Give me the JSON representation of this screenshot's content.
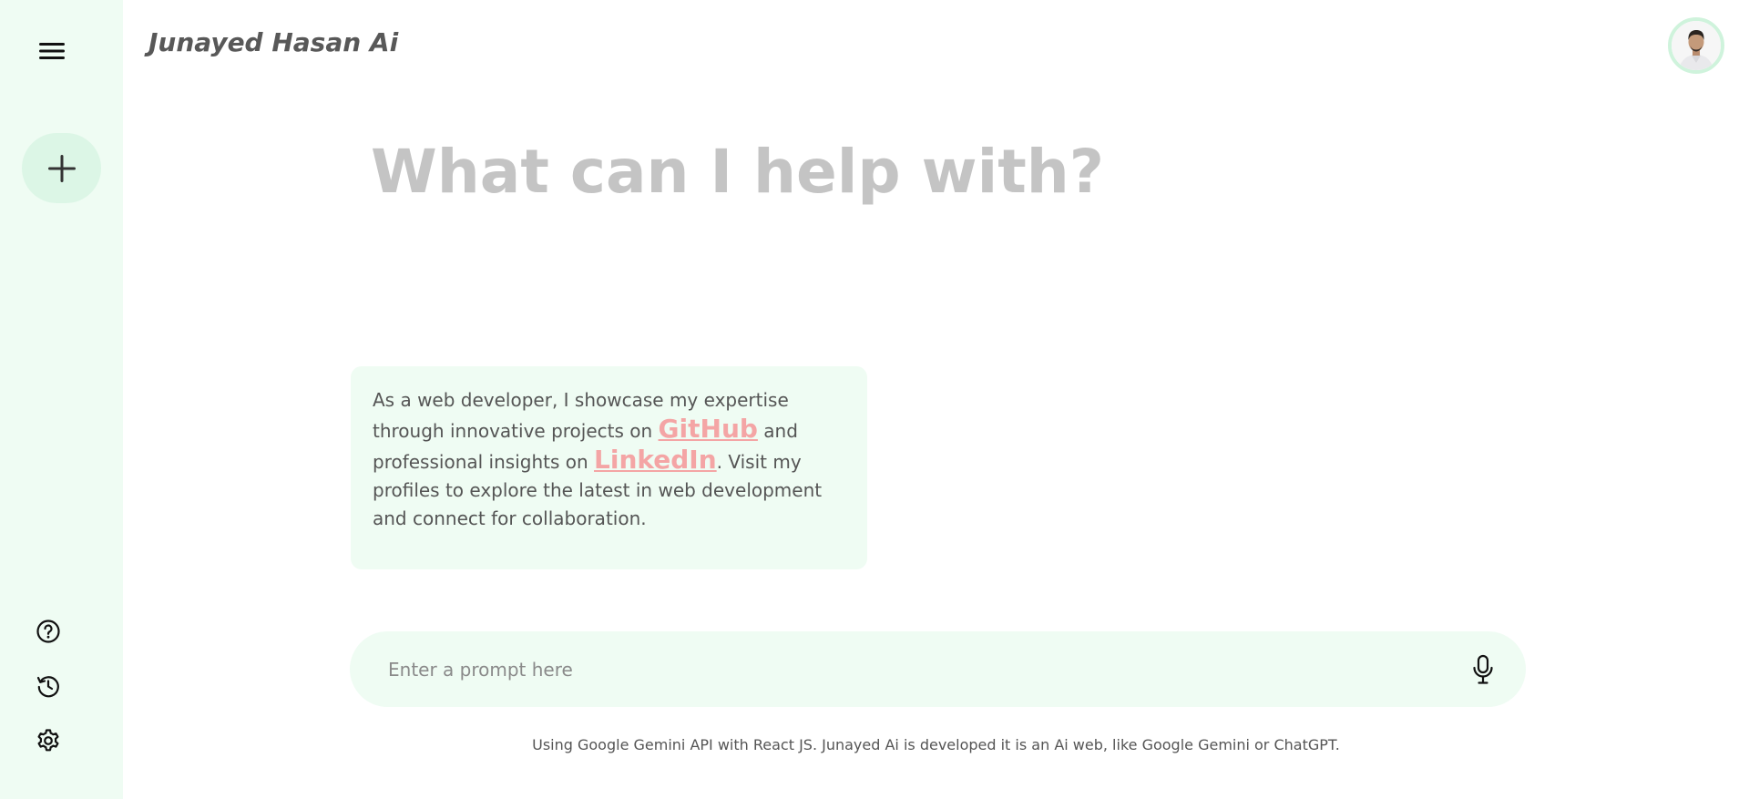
{
  "header": {
    "app_title": "Junayed Hasan Ai"
  },
  "sidebar": {
    "icons": {
      "menu": "hamburger-menu-icon",
      "new_chat": "plus-icon",
      "help": "question-icon",
      "history": "history-icon",
      "settings": "gear-icon"
    }
  },
  "main": {
    "greeting": "What can I help with?",
    "card": {
      "text_1": "As a web developer, I showcase my expertise through innovative projects on ",
      "link_github": "GitHub",
      "text_2": " and professional insights on ",
      "link_linkedin": "LinkedIn",
      "text_3": ". Visit my profiles to explore the latest in web development and connect for collaboration."
    }
  },
  "prompt": {
    "placeholder": "Enter a prompt here",
    "value": ""
  },
  "footer": {
    "note": "Using Google Gemini API with React JS. Junayed Ai is developed it is an Ai web, like Google Gemini or ChatGPT."
  },
  "colors": {
    "sidebar_bg": "#effcf3",
    "accent_link": "#f4a5a5",
    "greeting_text": "#c4c4c4"
  }
}
